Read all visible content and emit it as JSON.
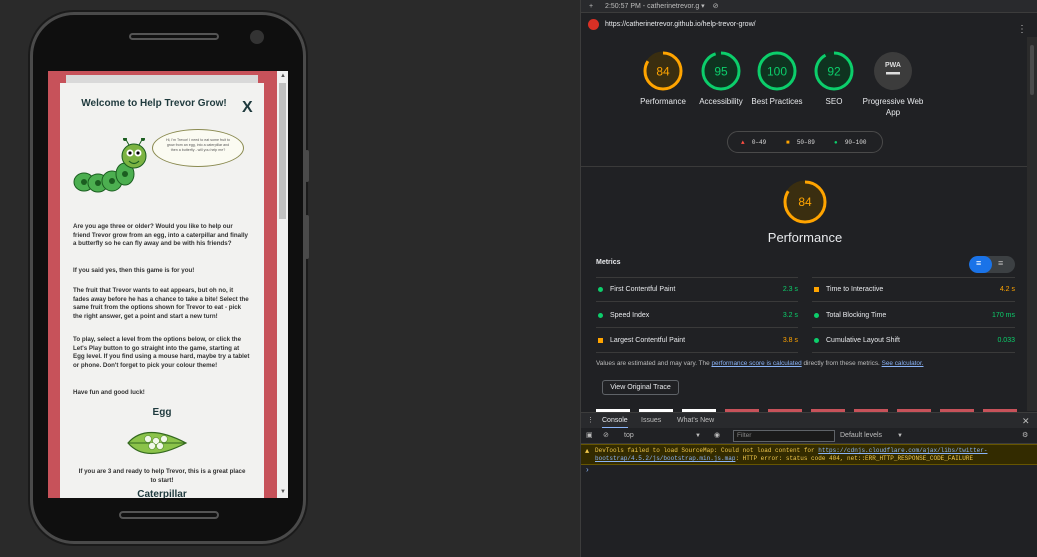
{
  "device": {
    "site": {
      "title": "Welcome to Help Trevor Grow!",
      "close": "X",
      "speech": "Hi, I'm Trevor! I need to eat some fruit to grow from an egg, into a caterpillar and then a butterfly - will you help me?",
      "paragraphs": [
        "Are you age three or older? Would you like to help our friend Trevor grow from an egg, into a caterpillar and finally a butterfly so he can fly away and be with his friends?",
        "If you said yes, then this game is for you!",
        "The fruit that Trevor wants to eat appears, but oh no, it fades away before he has a chance to take a bite! Select the same fruit from the options shown for Trevor to eat - pick the right answer, get a point and start a new turn!",
        "To play, select a level from the options below, or click the Let's Play button to go straight into the game, starting at Egg level. If you find using a mouse hard, maybe try a tablet or phone. Don't forget to pick your colour theme!",
        "Have fun and good luck!"
      ],
      "level_title": "Egg",
      "level_text": "If you are 3 and ready to help Trevor, this is a great place to start!",
      "next_level_partial": "Caterpillar"
    }
  },
  "devtools": {
    "header": {
      "time": "2:50:57 PM - catherinetrevor.g"
    },
    "url": "https://catherinetrevor.github.io/help-trevor-grow/",
    "gauges": [
      {
        "label": "Performance",
        "score": "84",
        "color": "#ffa400"
      },
      {
        "label": "Accessibility",
        "score": "95",
        "color": "#0cce6b"
      },
      {
        "label": "Best Practices",
        "score": "100",
        "color": "#0cce6b"
      },
      {
        "label": "SEO",
        "score": "92",
        "color": "#0cce6b"
      },
      {
        "label": "Progressive Web App",
        "score": "PWA",
        "color": "#9e9e9e"
      }
    ],
    "legend": [
      {
        "range": "0–49",
        "color": "#ff4e42"
      },
      {
        "range": "50–89",
        "color": "#ffa400"
      },
      {
        "range": "90–100",
        "color": "#0cce6b"
      }
    ],
    "performance": {
      "score": "84",
      "title": "Performance"
    },
    "metrics_heading": "Metrics",
    "metrics": [
      {
        "name": "First Contentful Paint",
        "value": "2.3 s",
        "status": "good"
      },
      {
        "name": "Time to Interactive",
        "value": "4.2 s",
        "status": "average"
      },
      {
        "name": "Speed Index",
        "value": "3.2 s",
        "status": "good"
      },
      {
        "name": "Total Blocking Time",
        "value": "170 ms",
        "status": "good"
      },
      {
        "name": "Largest Contentful Paint",
        "value": "3.8 s",
        "status": "average"
      },
      {
        "name": "Cumulative Layout Shift",
        "value": "0.033",
        "status": "good"
      }
    ],
    "note": {
      "pre": "Values are estimated and may vary. The ",
      "link1": "performance score is calculated",
      "mid": " directly from these metrics. ",
      "link2": "See calculator."
    },
    "trace_button": "View Original Trace",
    "console": {
      "tabs": [
        "Console",
        "Issues",
        "What's New"
      ],
      "context": "top",
      "filter_placeholder": "Filter",
      "levels": "Default levels",
      "warning_pre": "DevTools failed to load SourceMap: Could not load content for ",
      "warning_link": "https://cdnjs.cloudflare.com/ajax/libs/twitter-bootstrap/4.5.2/js/bootstrap.min.js.map",
      "warning_post": ": HTTP error: status code 404, net::ERR_HTTP_RESPONSE_CODE_FAILURE"
    }
  }
}
